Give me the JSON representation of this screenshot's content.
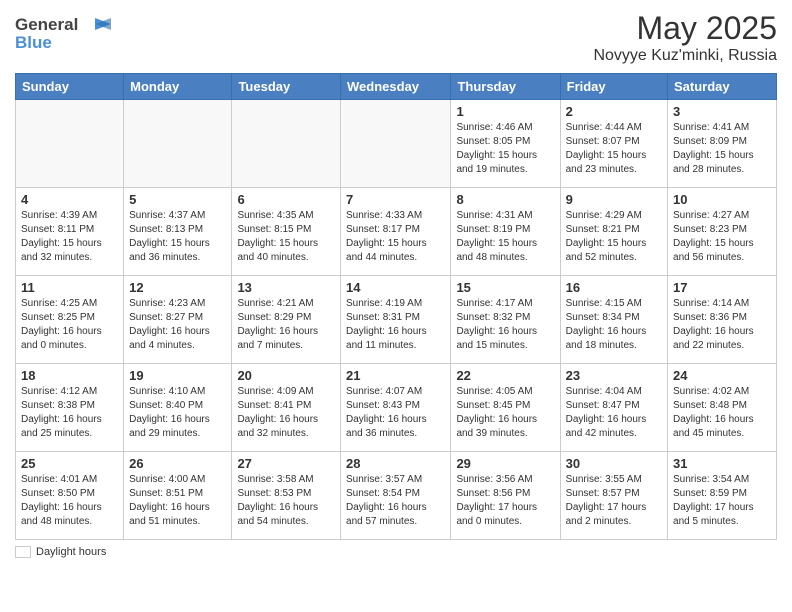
{
  "header": {
    "logo_line1": "General",
    "logo_line2": "Blue",
    "title": "May 2025",
    "subtitle": "Novyye Kuz'minki, Russia"
  },
  "days_of_week": [
    "Sunday",
    "Monday",
    "Tuesday",
    "Wednesday",
    "Thursday",
    "Friday",
    "Saturday"
  ],
  "weeks": [
    [
      {
        "day": "",
        "info": "",
        "empty": true
      },
      {
        "day": "",
        "info": "",
        "empty": true
      },
      {
        "day": "",
        "info": "",
        "empty": true
      },
      {
        "day": "",
        "info": "",
        "empty": true
      },
      {
        "day": "1",
        "info": "Sunrise: 4:46 AM\nSunset: 8:05 PM\nDaylight: 15 hours\nand 19 minutes."
      },
      {
        "day": "2",
        "info": "Sunrise: 4:44 AM\nSunset: 8:07 PM\nDaylight: 15 hours\nand 23 minutes."
      },
      {
        "day": "3",
        "info": "Sunrise: 4:41 AM\nSunset: 8:09 PM\nDaylight: 15 hours\nand 28 minutes."
      }
    ],
    [
      {
        "day": "4",
        "info": "Sunrise: 4:39 AM\nSunset: 8:11 PM\nDaylight: 15 hours\nand 32 minutes."
      },
      {
        "day": "5",
        "info": "Sunrise: 4:37 AM\nSunset: 8:13 PM\nDaylight: 15 hours\nand 36 minutes."
      },
      {
        "day": "6",
        "info": "Sunrise: 4:35 AM\nSunset: 8:15 PM\nDaylight: 15 hours\nand 40 minutes."
      },
      {
        "day": "7",
        "info": "Sunrise: 4:33 AM\nSunset: 8:17 PM\nDaylight: 15 hours\nand 44 minutes."
      },
      {
        "day": "8",
        "info": "Sunrise: 4:31 AM\nSunset: 8:19 PM\nDaylight: 15 hours\nand 48 minutes."
      },
      {
        "day": "9",
        "info": "Sunrise: 4:29 AM\nSunset: 8:21 PM\nDaylight: 15 hours\nand 52 minutes."
      },
      {
        "day": "10",
        "info": "Sunrise: 4:27 AM\nSunset: 8:23 PM\nDaylight: 15 hours\nand 56 minutes."
      }
    ],
    [
      {
        "day": "11",
        "info": "Sunrise: 4:25 AM\nSunset: 8:25 PM\nDaylight: 16 hours\nand 0 minutes."
      },
      {
        "day": "12",
        "info": "Sunrise: 4:23 AM\nSunset: 8:27 PM\nDaylight: 16 hours\nand 4 minutes."
      },
      {
        "day": "13",
        "info": "Sunrise: 4:21 AM\nSunset: 8:29 PM\nDaylight: 16 hours\nand 7 minutes."
      },
      {
        "day": "14",
        "info": "Sunrise: 4:19 AM\nSunset: 8:31 PM\nDaylight: 16 hours\nand 11 minutes."
      },
      {
        "day": "15",
        "info": "Sunrise: 4:17 AM\nSunset: 8:32 PM\nDaylight: 16 hours\nand 15 minutes."
      },
      {
        "day": "16",
        "info": "Sunrise: 4:15 AM\nSunset: 8:34 PM\nDaylight: 16 hours\nand 18 minutes."
      },
      {
        "day": "17",
        "info": "Sunrise: 4:14 AM\nSunset: 8:36 PM\nDaylight: 16 hours\nand 22 minutes."
      }
    ],
    [
      {
        "day": "18",
        "info": "Sunrise: 4:12 AM\nSunset: 8:38 PM\nDaylight: 16 hours\nand 25 minutes."
      },
      {
        "day": "19",
        "info": "Sunrise: 4:10 AM\nSunset: 8:40 PM\nDaylight: 16 hours\nand 29 minutes."
      },
      {
        "day": "20",
        "info": "Sunrise: 4:09 AM\nSunset: 8:41 PM\nDaylight: 16 hours\nand 32 minutes."
      },
      {
        "day": "21",
        "info": "Sunrise: 4:07 AM\nSunset: 8:43 PM\nDaylight: 16 hours\nand 36 minutes."
      },
      {
        "day": "22",
        "info": "Sunrise: 4:05 AM\nSunset: 8:45 PM\nDaylight: 16 hours\nand 39 minutes."
      },
      {
        "day": "23",
        "info": "Sunrise: 4:04 AM\nSunset: 8:47 PM\nDaylight: 16 hours\nand 42 minutes."
      },
      {
        "day": "24",
        "info": "Sunrise: 4:02 AM\nSunset: 8:48 PM\nDaylight: 16 hours\nand 45 minutes."
      }
    ],
    [
      {
        "day": "25",
        "info": "Sunrise: 4:01 AM\nSunset: 8:50 PM\nDaylight: 16 hours\nand 48 minutes."
      },
      {
        "day": "26",
        "info": "Sunrise: 4:00 AM\nSunset: 8:51 PM\nDaylight: 16 hours\nand 51 minutes."
      },
      {
        "day": "27",
        "info": "Sunrise: 3:58 AM\nSunset: 8:53 PM\nDaylight: 16 hours\nand 54 minutes."
      },
      {
        "day": "28",
        "info": "Sunrise: 3:57 AM\nSunset: 8:54 PM\nDaylight: 16 hours\nand 57 minutes."
      },
      {
        "day": "29",
        "info": "Sunrise: 3:56 AM\nSunset: 8:56 PM\nDaylight: 17 hours\nand 0 minutes."
      },
      {
        "day": "30",
        "info": "Sunrise: 3:55 AM\nSunset: 8:57 PM\nDaylight: 17 hours\nand 2 minutes."
      },
      {
        "day": "31",
        "info": "Sunrise: 3:54 AM\nSunset: 8:59 PM\nDaylight: 17 hours\nand 5 minutes."
      }
    ]
  ],
  "legend": {
    "label": "Daylight hours"
  }
}
